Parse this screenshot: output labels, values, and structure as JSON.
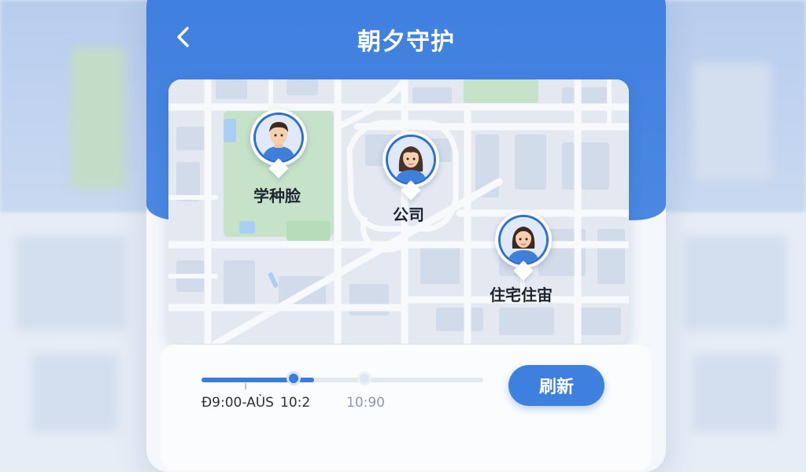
{
  "app": {
    "title": "朝夕守护"
  },
  "header": {
    "back_icon": "chevron-left-icon"
  },
  "map": {
    "pins": [
      {
        "label": "学种脸",
        "avatar": "boy-avatar"
      },
      {
        "label": "公司",
        "avatar": "girl-avatar"
      },
      {
        "label": "住宅住宙",
        "avatar": "woman-avatar"
      }
    ]
  },
  "timeline": {
    "progress": 0.4,
    "labels": {
      "start": "Ð9:00-AÙS",
      "current": "10:2",
      "end": "10:90"
    }
  },
  "actions": {
    "refresh_label": "刷新"
  },
  "colors": {
    "brand": "#3f7fde",
    "park": "#bfe0c2",
    "water": "#a9d0f3",
    "road": "#f7f9fc"
  }
}
